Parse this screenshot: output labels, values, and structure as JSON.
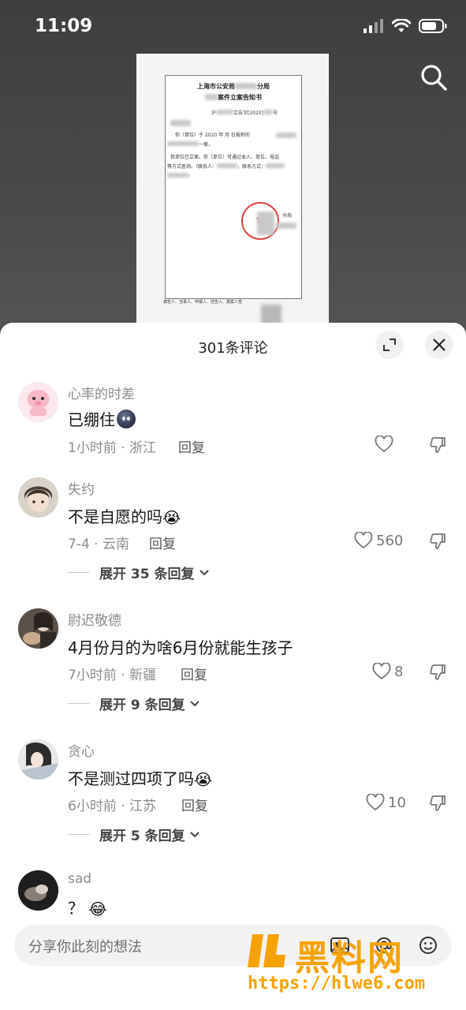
{
  "status_bar": {
    "time": "11:09"
  },
  "document": {
    "title_line1": "上海市公安局",
    "title_line1_suffix": "分局",
    "title_line2": "案件立案告知书",
    "number_prefix": "沪",
    "number_mid": "立告字[2020]",
    "number_suffix": "号",
    "body_line1": "你（单位）于 2020 年 月 日报称的",
    "body_line2": "一案，",
    "body_line3": "我单位已立案。你（单位）可通过本人、单位、电话",
    "body_line4": "等方式查询。（联系人：",
    "body_line5": "，联系方式：",
    "body_line6": "）",
    "seal_text": "分局",
    "footer": "被告人、当事人、申报人、控告人、报案人签"
  },
  "sheet": {
    "title": "301条评论"
  },
  "comments": [
    {
      "user": "心率的时差",
      "text": "已绷住",
      "time_location": "1小时前 · 浙江",
      "reply_label": "回复",
      "likes": "",
      "expand": ""
    },
    {
      "user": "失约",
      "text": "不是自愿的吗",
      "time_location": "7-4 · 云南",
      "reply_label": "回复",
      "likes": "560",
      "expand": "展开 35 条回复"
    },
    {
      "user": "尉迟敬德",
      "text": "4月份月的为啥6月份就能生孩子",
      "time_location": "7小时前 · 新疆",
      "reply_label": "回复",
      "likes": "8",
      "expand": "展开 9 条回复"
    },
    {
      "user": "贪心",
      "text": "不是测过四项了吗",
      "time_location": "6小时前 · 江苏",
      "reply_label": "回复",
      "likes": "10",
      "expand": "展开 5 条回复"
    },
    {
      "user": "sad",
      "text": "？",
      "time_location": "",
      "reply_label": "",
      "likes": "",
      "expand": ""
    }
  ],
  "input": {
    "placeholder": "分享你此刻的想法"
  },
  "watermark": {
    "text": "黑料网",
    "url": "https://hlwe6.com"
  },
  "colors": {
    "accent_watermark": "#f5a300",
    "seal_red": "#d9473f"
  },
  "icons": [
    "search-icon",
    "expand-icon",
    "close-icon",
    "heart-icon",
    "dislike-icon",
    "at-icon",
    "emoji-icon",
    "image-icon"
  ]
}
